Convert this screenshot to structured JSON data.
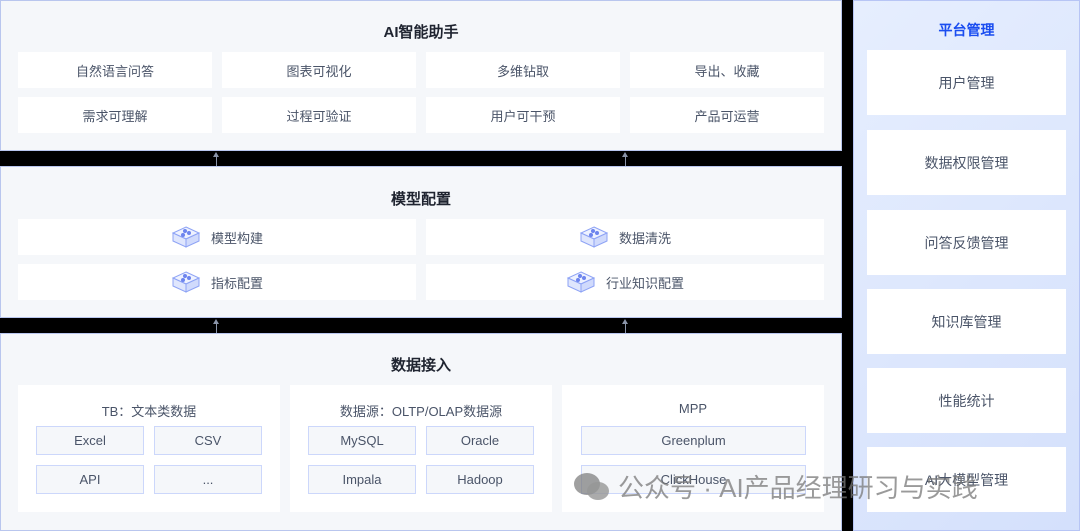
{
  "ai_assistant": {
    "title": "AI智能助手",
    "items": [
      "自然语言问答",
      "图表可视化",
      "多维钻取",
      "导出、收藏",
      "需求可理解",
      "过程可验证",
      "用户可干预",
      "产品可运营"
    ]
  },
  "model_config": {
    "title": "模型配置",
    "items": [
      "模型构建",
      "数据清洗",
      "指标配置",
      "行业知识配置"
    ]
  },
  "data_ingest": {
    "title": "数据接入",
    "cards": [
      {
        "title": "TB：文本类数据",
        "items": [
          "Excel",
          "CSV",
          "API",
          "..."
        ]
      },
      {
        "title": "数据源：OLTP/OLAP数据源",
        "items": [
          "MySQL",
          "Oracle",
          "Impala",
          "Hadoop"
        ]
      },
      {
        "title": "MPP",
        "items": [
          "Greenplum",
          "ClickHouse"
        ]
      }
    ]
  },
  "platform": {
    "title": "平台管理",
    "items": [
      "用户管理",
      "数据权限管理",
      "问答反馈管理",
      "知识库管理",
      "性能统计",
      "AI大模型管理"
    ]
  },
  "watermark": "公众号 · AI产品经理研习与实践"
}
